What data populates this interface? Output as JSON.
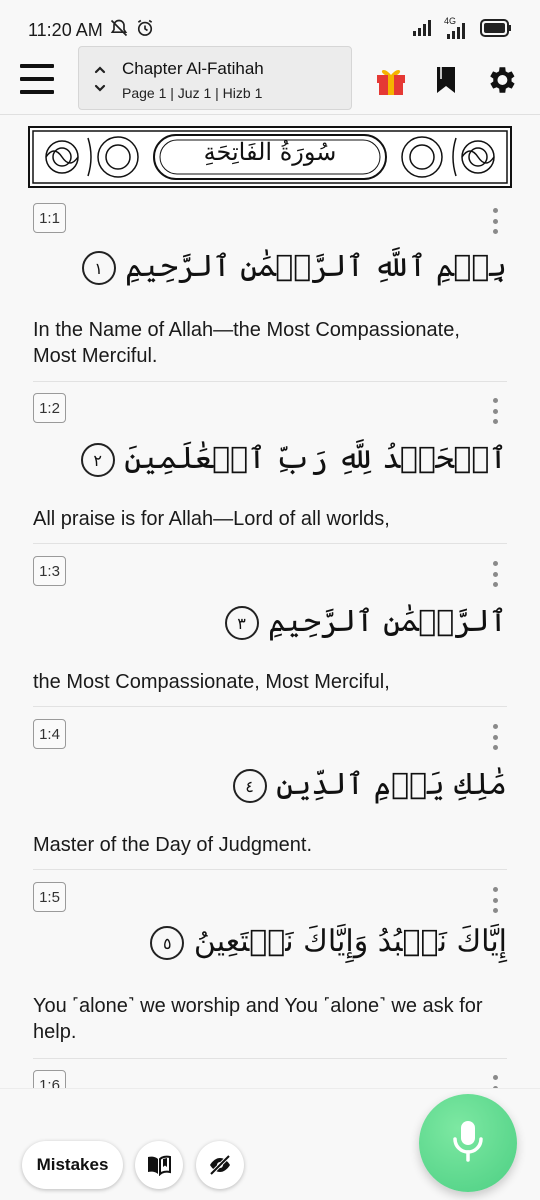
{
  "status_bar": {
    "time": "11:20 AM",
    "icons": [
      "bell-off-icon",
      "alarm-icon",
      "signal-icon",
      "4g-signal-icon",
      "battery-icon"
    ],
    "network_label": "4G"
  },
  "header": {
    "chapter_title": "Chapter Al-Fatihah",
    "chapter_meta": "Page 1 | Juz 1 | Hizb 1",
    "icons": [
      "menu-icon",
      "gift-icon",
      "bookmark-icon",
      "settings-icon"
    ]
  },
  "surah_header": {
    "arabic_title": "سُورَةُ الفَاتِحَةِ"
  },
  "verses": [
    {
      "ref": "1:1",
      "arabic": "بِسۡمِ ٱللَّهِ ٱلرَّحۡمَٰنِ ٱلرَّحِيمِ",
      "number": "١",
      "translation": "In the Name of Allah—the Most Compassionate, Most Merciful."
    },
    {
      "ref": "1:2",
      "arabic": "ٱلۡحَمۡدُ لِلَّهِ رَبِّ ٱلۡعَٰلَمِينَ",
      "number": "٢",
      "translation": "All praise is for Allah—Lord of all worlds,"
    },
    {
      "ref": "1:3",
      "arabic": "ٱلرَّحۡمَٰنِ ٱلرَّحِيمِ",
      "number": "٣",
      "translation": "the Most Compassionate, Most Merciful,"
    },
    {
      "ref": "1:4",
      "arabic": "مَٰلِكِ يَوۡمِ ٱلدِّينِ",
      "number": "٤",
      "translation": "Master of the Day of Judgment."
    },
    {
      "ref": "1:5",
      "arabic": "إِيَّاكَ نَعۡبُدُ وَإِيَّاكَ نَسۡتَعِينُ",
      "number": "٥",
      "translation": "You ˹alone˺ we worship and You ˹alone˺ we ask for help."
    },
    {
      "ref": "1:6"
    }
  ],
  "bottom_bar": {
    "mistakes_label": "Mistakes",
    "icons": [
      "book-open-icon",
      "eye-off-icon",
      "microphone-icon"
    ]
  },
  "colors": {
    "background": "#f8f8f8",
    "mic_green": "#4ccf83",
    "gift_red": "#e53935",
    "gift_gold": "#f5b400"
  }
}
